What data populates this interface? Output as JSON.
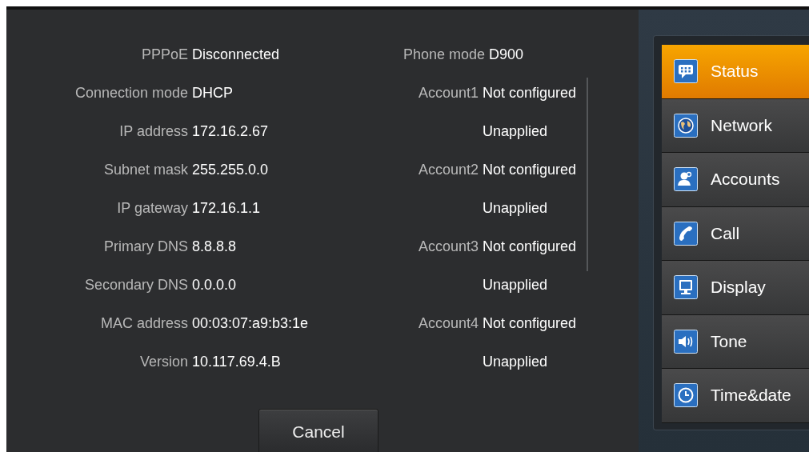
{
  "status_left": [
    {
      "label": "PPPoE",
      "value": "Disconnected"
    },
    {
      "label": "Connection mode",
      "value": "DHCP"
    },
    {
      "label": "IP address",
      "value": "172.16.2.67"
    },
    {
      "label": "Subnet mask",
      "value": "255.255.0.0"
    },
    {
      "label": "IP gateway",
      "value": "172.16.1.1"
    },
    {
      "label": "Primary DNS",
      "value": "8.8.8.8"
    },
    {
      "label": "Secondary DNS",
      "value": "0.0.0.0"
    },
    {
      "label": "MAC address",
      "value": "00:03:07:a9:b3:1e"
    },
    {
      "label": "Version",
      "value": "10.117.69.4.B"
    }
  ],
  "status_right": [
    {
      "label": "Phone mode",
      "value": "D900"
    },
    {
      "label": "Account1",
      "value": "Not configured"
    },
    {
      "value": "Unapplied"
    },
    {
      "label": "Account2",
      "value": "Not configured"
    },
    {
      "value": "Unapplied"
    },
    {
      "label": "Account3",
      "value": "Not configured"
    },
    {
      "value": "Unapplied"
    },
    {
      "label": "Account4",
      "value": "Not configured"
    },
    {
      "value": "Unapplied"
    }
  ],
  "buttons": [
    "Cancel"
  ],
  "menu": [
    {
      "label": "Status",
      "selected": true
    },
    {
      "label": "Network",
      "selected": false
    },
    {
      "label": "Accounts",
      "selected": false
    },
    {
      "label": "Call",
      "selected": false
    },
    {
      "label": "Display",
      "selected": false
    },
    {
      "label": "Tone",
      "selected": false
    },
    {
      "label": "Time&date",
      "selected": false
    }
  ]
}
